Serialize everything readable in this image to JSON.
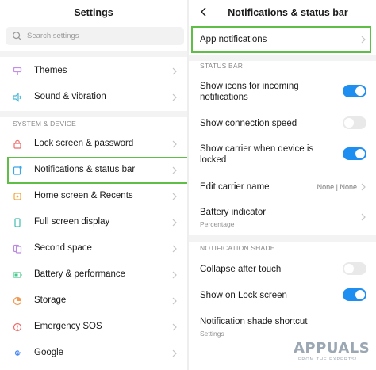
{
  "left": {
    "title": "Settings",
    "search_placeholder": "Search settings",
    "items_top": [
      {
        "label": "Themes",
        "icon": "brush-icon",
        "color": "#c48fe6"
      },
      {
        "label": "Sound & vibration",
        "icon": "speaker-icon",
        "color": "#4ab8d7"
      }
    ],
    "section_label": "SYSTEM & DEVICE",
    "items_system": [
      {
        "label": "Lock screen & password",
        "icon": "lock-icon",
        "color": "#ef6b6b"
      },
      {
        "label": "Notifications & status bar",
        "icon": "notification-icon",
        "color": "#3aa7e8",
        "highlighted": true
      },
      {
        "label": "Home screen & Recents",
        "icon": "home-icon",
        "color": "#f5a742"
      },
      {
        "label": "Full screen display",
        "icon": "fullscreen-icon",
        "color": "#3fbfb2"
      },
      {
        "label": "Second space",
        "icon": "second-space-icon",
        "color": "#b98ae0"
      },
      {
        "label": "Battery & performance",
        "icon": "battery-icon",
        "color": "#46c98a"
      },
      {
        "label": "Storage",
        "icon": "storage-icon",
        "color": "#f29a54"
      },
      {
        "label": "Emergency SOS",
        "icon": "sos-icon",
        "color": "#ef6b6b"
      },
      {
        "label": "Google",
        "icon": "google-icon",
        "color": "#4a8af4"
      }
    ]
  },
  "right": {
    "title": "Notifications & status bar",
    "app_notifications": "App notifications",
    "section_status_bar": "STATUS BAR",
    "show_icons": {
      "label": "Show icons for incoming notifications",
      "on": true
    },
    "show_speed": {
      "label": "Show connection speed",
      "on": false
    },
    "show_carrier": {
      "label": "Show carrier when device is locked",
      "on": true
    },
    "edit_carrier": {
      "label": "Edit carrier name",
      "value": "None | None"
    },
    "battery_indicator": {
      "label": "Battery indicator",
      "sub": "Percentage"
    },
    "section_shade": "NOTIFICATION SHADE",
    "collapse": {
      "label": "Collapse after touch",
      "on": false
    },
    "show_lock": {
      "label": "Show on Lock screen",
      "on": true
    },
    "shade_shortcut": {
      "label": "Notification shade shortcut",
      "sub": "Settings"
    }
  },
  "watermark": {
    "main": "APPUALS",
    "sub": "FROM THE EXPERTS!"
  },
  "colors": {
    "toggle_on": "#1f8ef1",
    "highlight": "#5fbe46"
  }
}
